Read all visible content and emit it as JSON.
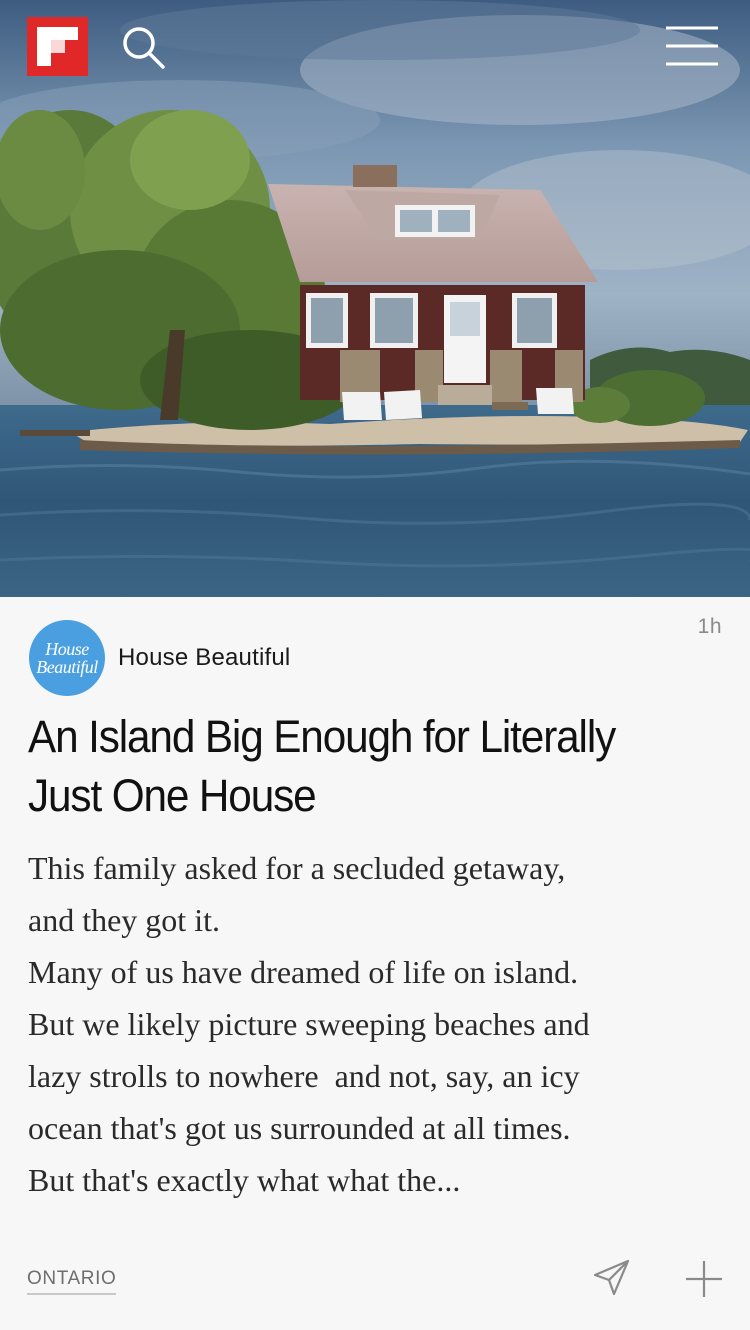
{
  "app": {
    "name": "Flipboard",
    "accent_color": "#e12828"
  },
  "header": {
    "logo_icon": "flipboard-logo-icon",
    "search_icon": "search-icon",
    "menu_icon": "hamburger-menu-icon"
  },
  "article": {
    "hero_image": "island-house-photo",
    "timestamp": "1h",
    "source": {
      "name": "House Beautiful",
      "avatar_line1": "House",
      "avatar_line2": "Beautiful",
      "avatar_color": "#4a9fe0"
    },
    "title_line1": "An Island Big Enough for Literally",
    "title_line2": "Just One House",
    "excerpt_lines": [
      "This family asked for a secluded getaway,",
      "and they got it.",
      "Many of us have dreamed of life on island.",
      "But we likely picture sweeping beaches and",
      "lazy strolls to nowhere  and not, say, an icy",
      "ocean that's got us surrounded at all times.",
      "But that's exactly what what the..."
    ]
  },
  "footer": {
    "topic": "ONTARIO",
    "share_icon": "share-paper-plane-icon",
    "add_icon": "plus-icon"
  }
}
